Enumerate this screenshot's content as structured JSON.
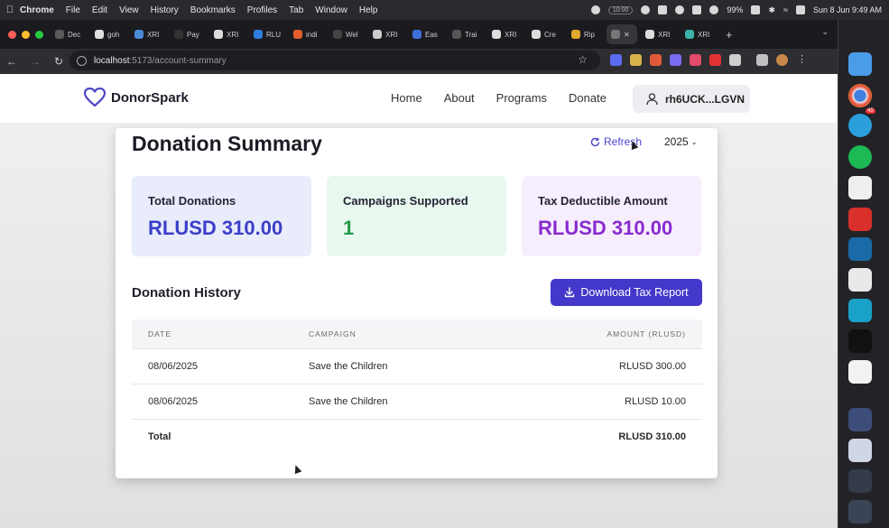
{
  "menubar": {
    "app_name": "Chrome",
    "menus": [
      "File",
      "Edit",
      "View",
      "History",
      "Bookmarks",
      "Profiles",
      "Tab",
      "Window",
      "Help"
    ],
    "timer": "10:00",
    "battery": "99%",
    "datetime": "Sun 8 Jun  9:49 AM"
  },
  "browser": {
    "tabs": [
      {
        "label": "Dec",
        "color": "#5b5b5b"
      },
      {
        "label": "goh",
        "color": "#e0e0e0"
      },
      {
        "label": "XRI",
        "color": "#4b8bd6"
      },
      {
        "label": "Pay",
        "color": "#333333"
      },
      {
        "label": "XRI",
        "color": "#dddddd"
      },
      {
        "label": "RLU",
        "color": "#2f7de1"
      },
      {
        "label": "indi",
        "color": "#e35d2d"
      },
      {
        "label": "Wel",
        "color": "#444444"
      },
      {
        "label": "XRI",
        "color": "#cccccc"
      },
      {
        "label": "Eas",
        "color": "#3d6fd8"
      },
      {
        "label": "Trai",
        "color": "#555555"
      },
      {
        "label": "XRI",
        "color": "#dddddd"
      },
      {
        "label": "Cre",
        "color": "#dddddd"
      },
      {
        "label": "Rip",
        "color": "#e3a72d"
      },
      {
        "label": "XRI",
        "color": "#dddddd"
      },
      {
        "label": "XRI",
        "color": "#3bb3a8"
      }
    ],
    "url_host": "localhost",
    "url_path": ":5173/account-summary"
  },
  "header": {
    "brand": "DonorSpark",
    "nav": [
      "Home",
      "About",
      "Programs",
      "Donate"
    ],
    "user": "rh6UCK...LGVN"
  },
  "summary": {
    "title": "Donation Summary",
    "refresh_label": "Refresh",
    "year": "2025",
    "stats": [
      {
        "label": "Total Donations",
        "value": "RLUSD 310.00"
      },
      {
        "label": "Campaigns Supported",
        "value": "1"
      },
      {
        "label": "Tax Deductible Amount",
        "value": "RLUSD 310.00"
      }
    ]
  },
  "history": {
    "title": "Donation History",
    "download_label": "Download Tax Report",
    "columns": [
      "DATE",
      "CAMPAIGN",
      "AMOUNT (RLUSD)"
    ],
    "rows": [
      {
        "date": "08/06/2025",
        "campaign": "Save the Children",
        "amount": "RLUSD 300.00"
      },
      {
        "date": "08/06/2025",
        "campaign": "Save the Children",
        "amount": "RLUSD 10.00"
      }
    ],
    "total_label": "Total",
    "total_amount": "RLUSD 310.00"
  },
  "colors": {
    "accent": "#4338ca",
    "brand_heart": "#4f46c8",
    "campaigns_green": "#23994a",
    "tax_purple": "#8a2bd0"
  }
}
